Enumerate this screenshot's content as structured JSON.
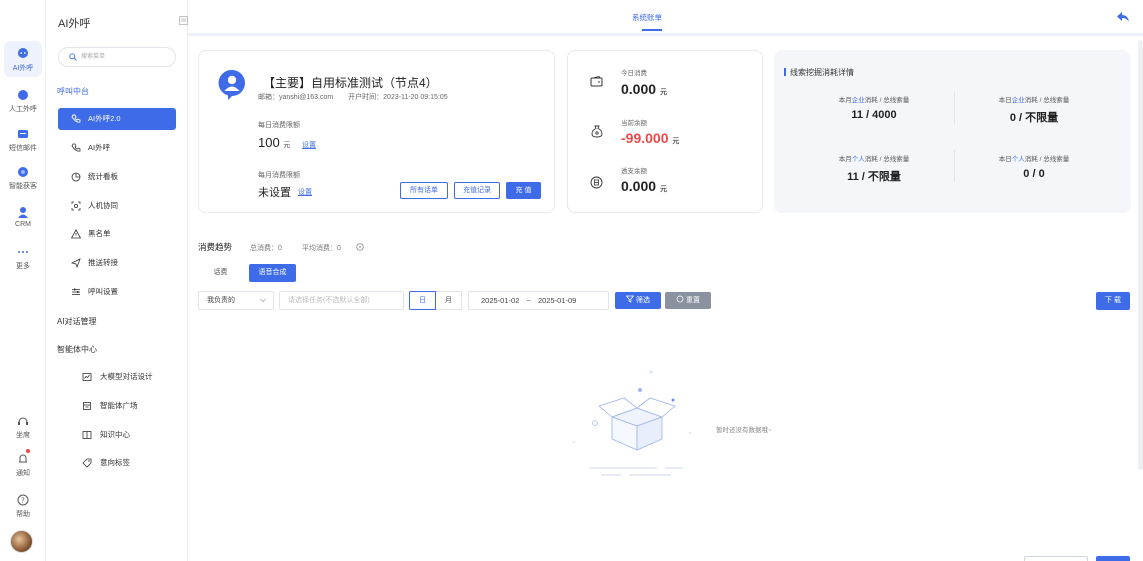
{
  "rail": {
    "items": [
      {
        "label": "AI外呼",
        "icon": "ai-call-icon",
        "active": true
      },
      {
        "label": "人工外呼",
        "icon": "manual-call-icon"
      },
      {
        "label": "短信邮件",
        "icon": "sms-mail-icon"
      },
      {
        "label": "智能获客",
        "icon": "smart-acquire-icon"
      },
      {
        "label": "CRM",
        "icon": "crm-icon"
      },
      {
        "label": "更多",
        "icon": "more-icon"
      }
    ],
    "bottom": [
      {
        "label": "坐席",
        "icon": "headset-icon"
      },
      {
        "label": "通知",
        "icon": "bell-icon"
      },
      {
        "label": "帮助",
        "icon": "help-icon"
      }
    ]
  },
  "sidebar": {
    "title": "AI外呼",
    "search_placeholder": "搜索菜单",
    "group1": "呼叫中台",
    "items1": [
      "AI外呼2.0",
      "AI外呼",
      "统计看板",
      "人机协同",
      "黑名单",
      "推送转接",
      "呼叫设置"
    ],
    "group2": "AI对话管理",
    "group3": "智能体中心",
    "items3": [
      "大模型对话设计",
      "智能体广场",
      "知识中心",
      "意向标签"
    ]
  },
  "topbar": {
    "tab": "系统账单"
  },
  "account": {
    "name": "【主要】自用标准测试（节点4）",
    "email": "邮箱：yanshi@163.com",
    "open_time": "开户时间：2023-11-20 09:15:05",
    "daily_limit_label": "每日消费限额",
    "daily_limit_value": "100",
    "unit": "元",
    "set_link": "设置",
    "monthly_limit_label": "每月消费限额",
    "monthly_limit_value": "未设置",
    "btn_all_bills": "所有话单",
    "btn_recharge_log": "充值记录",
    "btn_recharge": "充 值"
  },
  "balance": {
    "today_label": "今日消费",
    "today_value": "0.000",
    "current_label": "当前余额",
    "current_value": "-99.000",
    "credit_label": "透支余额",
    "credit_value": "0.000",
    "unit": "元"
  },
  "detail": {
    "title": "线索挖掘消耗详情",
    "cells": [
      {
        "prefix": "本月",
        "highlight": "企业",
        "suffix": "消耗 / 总线索量",
        "value": "11 / 4000"
      },
      {
        "prefix": "本日",
        "highlight": "企业",
        "suffix": "消耗 / 总线索量",
        "value": "0 / 不限量"
      },
      {
        "prefix": "本月",
        "highlight": "个人",
        "suffix": "消耗 / 总线索量",
        "value": "11 / 不限量"
      },
      {
        "prefix": "本日",
        "highlight": "个人",
        "suffix": "消耗 / 总线索量",
        "value": "0 / 0"
      }
    ]
  },
  "trend": {
    "title": "消费趋势",
    "total": "总消费：0",
    "avg": "平均消费：0",
    "tabs": [
      "话费",
      "语音合成"
    ],
    "owner_select": "我负责的",
    "task_placeholder": "请选择任务(不选默认全部)",
    "day": "日",
    "month": "月",
    "range_start": "2025-01-02",
    "range_sep": "~",
    "range_end": "2025-01-09",
    "filter_btn": "筛选",
    "reset_btn": "重置",
    "download_btn": "下 载",
    "empty_text": "暂时还没有数据哦~"
  },
  "colors": {
    "primary": "#3e6ce8",
    "negative": "#f04848"
  }
}
